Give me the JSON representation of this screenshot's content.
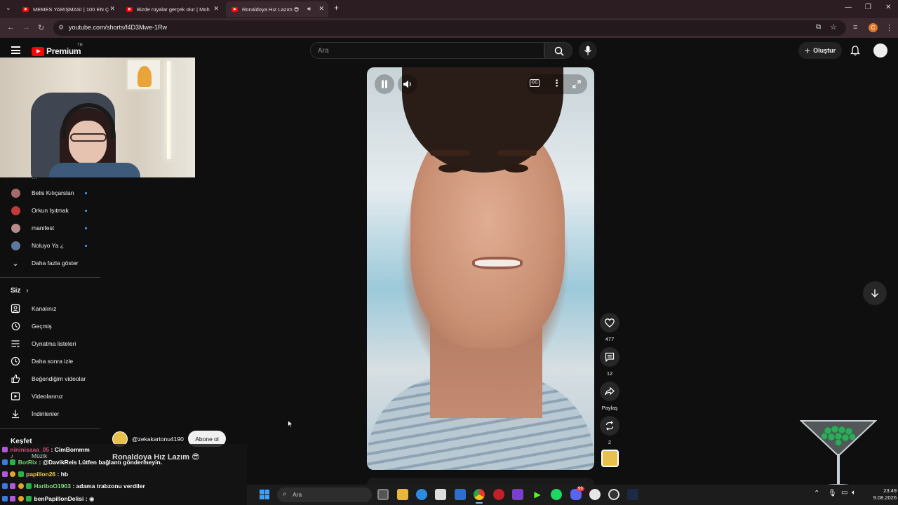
{
  "browser": {
    "tabs": [
      {
        "title": "MEMES YARIŞMASI | 100 EN Ç"
      },
      {
        "title": "Bizde rüyalar gerçek olur | Moh"
      },
      {
        "title": "Ronaldoya Hız Lazım 😎"
      }
    ],
    "url": "youtube.com/shorts/f4D3Mwe-1Rw",
    "profile_initial": "C"
  },
  "header": {
    "logo_text": "Premium",
    "region": "TR",
    "search_placeholder": "Ara",
    "create_label": "Oluştur"
  },
  "sidebar": {
    "subscriptions": [
      {
        "label": "Belis Kılıçarslan",
        "color": "#a86b6b"
      },
      {
        "label": "Orkun Işıtmak",
        "color": "#c23a3a"
      },
      {
        "label": "manifest",
        "color": "#b98b8b"
      },
      {
        "label": "Noluyo Ya ¿",
        "color": "#5b7a9a"
      }
    ],
    "show_more": "Daha fazla göster",
    "you_heading": "Siz",
    "you_items": [
      {
        "label": "Kanalınız",
        "icon": "channel-icon"
      },
      {
        "label": "Geçmiş",
        "icon": "history-icon"
      },
      {
        "label": "Oynatma listeleri",
        "icon": "playlists-icon"
      },
      {
        "label": "Daha sonra izle",
        "icon": "watch-later-icon"
      },
      {
        "label": "Beğendiğim videolar",
        "icon": "like-icon"
      },
      {
        "label": "Videolarınız",
        "icon": "your-videos-icon"
      },
      {
        "label": "İndirilenler",
        "icon": "download-icon"
      }
    ],
    "explore_heading": "Keşfet",
    "explore_items": [
      {
        "label": "Müzik"
      }
    ]
  },
  "short": {
    "likes": "477",
    "comments": "12",
    "share_label": "Paylaş",
    "remix_count": "2",
    "channel": "@zekakartonu4190",
    "subscribe_label": "Abone ol",
    "title": "Ronaldoya Hız Lazım 😎"
  },
  "chat": [
    {
      "user": "nininisaaa_05",
      "msg": ": CimBommm",
      "color": "#e0457b"
    },
    {
      "user": "BotRix",
      "msg": ": @DavikReis Lütfen bağlantı göndermeyin.",
      "color": "#6fd36f"
    },
    {
      "user": "papillon26",
      "msg": ": hb",
      "color": "#f3d24a"
    },
    {
      "user": "HariboO1903",
      "msg": ": adama trabzonu verdiler",
      "color": "#7fe07f"
    },
    {
      "user": "benPapillonDelisi",
      "msg": ":",
      "color": "#f1f1f1"
    }
  ],
  "taskbar": {
    "search_placeholder": "Ara",
    "time": "23:49",
    "date": "9.08.2026",
    "discord_badge": "99"
  }
}
